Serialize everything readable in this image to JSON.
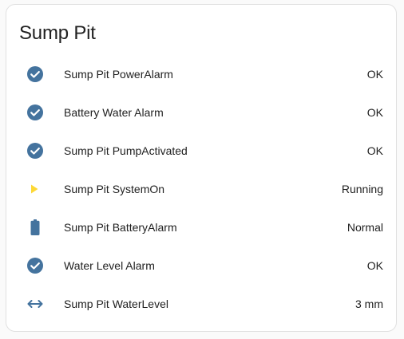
{
  "card": {
    "title": "Sump Pit",
    "entities": [
      {
        "name": "Sump Pit PowerAlarm",
        "state": "OK",
        "icon": "check-circle-icon",
        "icon_color": "#44739e"
      },
      {
        "name": "Battery Water Alarm",
        "state": "OK",
        "icon": "check-circle-icon",
        "icon_color": "#44739e"
      },
      {
        "name": "Sump Pit PumpActivated",
        "state": "OK",
        "icon": "check-circle-icon",
        "icon_color": "#44739e"
      },
      {
        "name": "Sump Pit SystemOn",
        "state": "Running",
        "icon": "play-icon",
        "icon_color": "#fdd835"
      },
      {
        "name": "Sump Pit BatteryAlarm",
        "state": "Normal",
        "icon": "battery-icon",
        "icon_color": "#44739e"
      },
      {
        "name": "Water Level Alarm",
        "state": "OK",
        "icon": "check-circle-icon",
        "icon_color": "#44739e"
      },
      {
        "name": "Sump Pit WaterLevel",
        "state": "3 mm",
        "icon": "arrow-left-right-icon",
        "icon_color": "#44739e"
      }
    ]
  }
}
